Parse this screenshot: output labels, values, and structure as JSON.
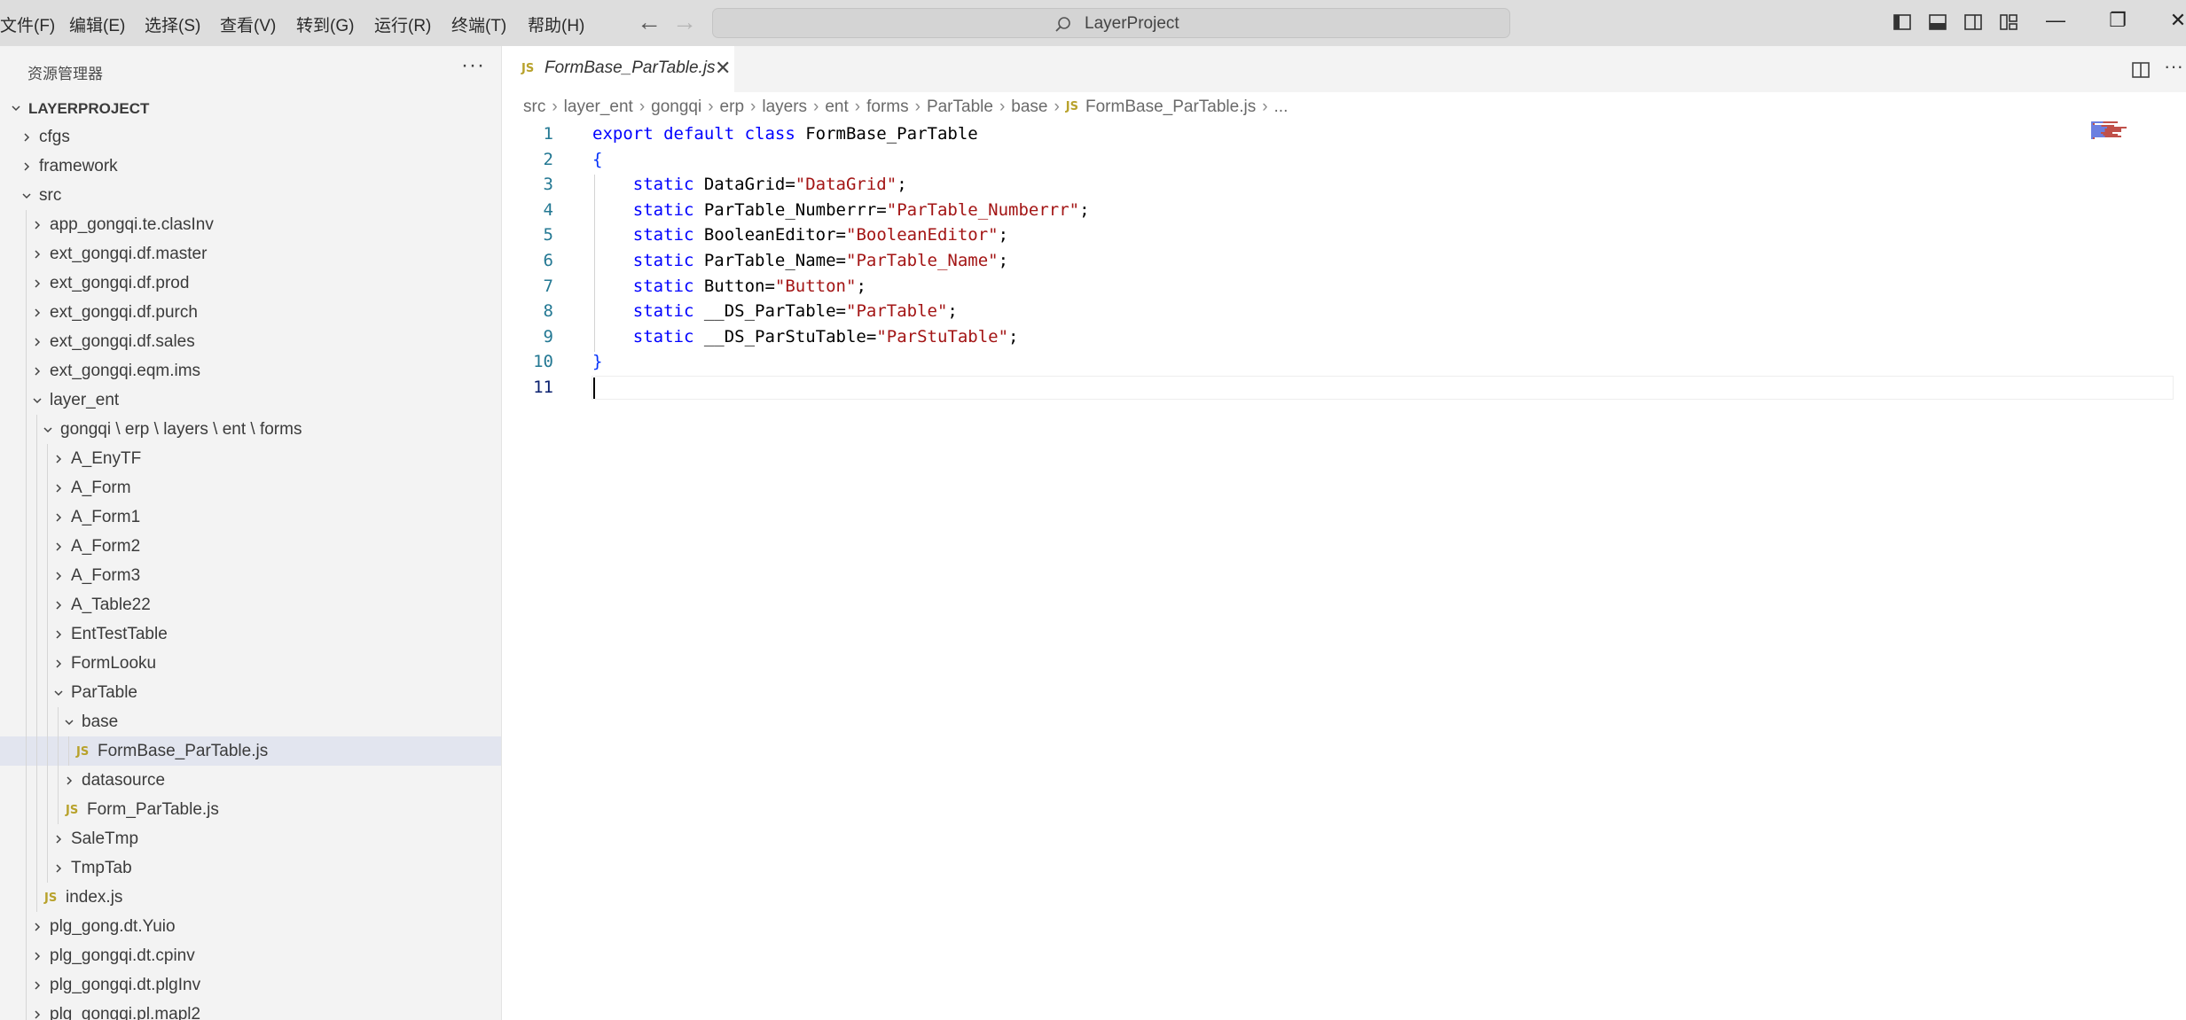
{
  "menu": [
    "文件(F)",
    "编辑(E)",
    "选择(S)",
    "查看(V)",
    "转到(G)",
    "运行(R)",
    "终端(T)",
    "帮助(H)"
  ],
  "title": {
    "search_text": "LayerProject"
  },
  "window_controls": {
    "minimize": "—",
    "restore": "❐",
    "close": "✕"
  },
  "sidebar": {
    "title": "资源管理器",
    "more": "···",
    "tree": [
      {
        "label": "LAYERPROJECT",
        "level": 0,
        "kind": "root-open"
      },
      {
        "label": "cfgs",
        "level": 1,
        "kind": "folder-closed"
      },
      {
        "label": "framework",
        "level": 1,
        "kind": "folder-closed"
      },
      {
        "label": "src",
        "level": 1,
        "kind": "folder-open"
      },
      {
        "label": "app_gongqi.te.clasInv",
        "level": 2,
        "kind": "folder-closed"
      },
      {
        "label": "ext_gongqi.df.master",
        "level": 2,
        "kind": "folder-closed"
      },
      {
        "label": "ext_gongqi.df.prod",
        "level": 2,
        "kind": "folder-closed"
      },
      {
        "label": "ext_gongqi.df.purch",
        "level": 2,
        "kind": "folder-closed"
      },
      {
        "label": "ext_gongqi.df.sales",
        "level": 2,
        "kind": "folder-closed"
      },
      {
        "label": "ext_gongqi.eqm.ims",
        "level": 2,
        "kind": "folder-closed"
      },
      {
        "label": "layer_ent",
        "level": 2,
        "kind": "folder-open"
      },
      {
        "label": "gongqi \\ erp \\ layers \\ ent \\ forms",
        "level": 3,
        "kind": "folder-open"
      },
      {
        "label": "A_EnyTF",
        "level": 4,
        "kind": "folder-closed"
      },
      {
        "label": "A_Form",
        "level": 4,
        "kind": "folder-closed"
      },
      {
        "label": "A_Form1",
        "level": 4,
        "kind": "folder-closed"
      },
      {
        "label": "A_Form2",
        "level": 4,
        "kind": "folder-closed"
      },
      {
        "label": "A_Form3",
        "level": 4,
        "kind": "folder-closed"
      },
      {
        "label": "A_Table22",
        "level": 4,
        "kind": "folder-closed"
      },
      {
        "label": "EntTestTable",
        "level": 4,
        "kind": "folder-closed"
      },
      {
        "label": "FormLooku",
        "level": 4,
        "kind": "folder-closed"
      },
      {
        "label": "ParTable",
        "level": 4,
        "kind": "folder-open"
      },
      {
        "label": "base",
        "level": 5,
        "kind": "folder-open"
      },
      {
        "label": "FormBase_ParTable.js",
        "level": 6,
        "kind": "js-file",
        "selected": true
      },
      {
        "label": "datasource",
        "level": 5,
        "kind": "folder-closed"
      },
      {
        "label": "Form_ParTable.js",
        "level": 5,
        "kind": "js-file"
      },
      {
        "label": "SaleTmp",
        "level": 4,
        "kind": "folder-closed"
      },
      {
        "label": "TmpTab",
        "level": 4,
        "kind": "folder-closed"
      },
      {
        "label": "index.js",
        "level": 3,
        "kind": "js-file"
      },
      {
        "label": "plg_gong.dt.Yuio",
        "level": 2,
        "kind": "folder-closed"
      },
      {
        "label": "plg_gongqi.dt.cpinv",
        "level": 2,
        "kind": "folder-closed"
      },
      {
        "label": "plg_gongqi.dt.plgInv",
        "level": 2,
        "kind": "folder-closed"
      },
      {
        "label": "plg_gongqi.pl.mapl2",
        "level": 2,
        "kind": "folder-closed"
      }
    ]
  },
  "tab": {
    "badge": "JS",
    "name": "FormBase_ParTable.js",
    "close": "✕"
  },
  "editor_more": "···",
  "breadcrumb": [
    "src",
    "layer_ent",
    "gongqi",
    "erp",
    "layers",
    "ent",
    "forms",
    "ParTable",
    "base",
    "FormBase_ParTable.js",
    "..."
  ],
  "code_lines": [
    [
      {
        "t": "export ",
        "c": "kw"
      },
      {
        "t": "default ",
        "c": "kw"
      },
      {
        "t": "class ",
        "c": "kw"
      },
      {
        "t": "FormBase_ParTable",
        "c": ""
      }
    ],
    [
      {
        "t": "{",
        "c": "brace"
      }
    ],
    [
      {
        "t": "    ",
        "c": ""
      },
      {
        "t": "static ",
        "c": "kw"
      },
      {
        "t": "DataGrid=",
        "c": ""
      },
      {
        "t": "\"DataGrid\"",
        "c": "str"
      },
      {
        "t": ";",
        "c": ""
      }
    ],
    [
      {
        "t": "    ",
        "c": ""
      },
      {
        "t": "static ",
        "c": "kw"
      },
      {
        "t": "ParTable_Numberrr=",
        "c": ""
      },
      {
        "t": "\"ParTable_Numberrr\"",
        "c": "str"
      },
      {
        "t": ";",
        "c": ""
      }
    ],
    [
      {
        "t": "    ",
        "c": ""
      },
      {
        "t": "static ",
        "c": "kw"
      },
      {
        "t": "BooleanEditor=",
        "c": ""
      },
      {
        "t": "\"BooleanEditor\"",
        "c": "str"
      },
      {
        "t": ";",
        "c": ""
      }
    ],
    [
      {
        "t": "    ",
        "c": ""
      },
      {
        "t": "static ",
        "c": "kw"
      },
      {
        "t": "ParTable_Name=",
        "c": ""
      },
      {
        "t": "\"ParTable_Name\"",
        "c": "str"
      },
      {
        "t": ";",
        "c": ""
      }
    ],
    [
      {
        "t": "    ",
        "c": ""
      },
      {
        "t": "static ",
        "c": "kw"
      },
      {
        "t": "Button=",
        "c": ""
      },
      {
        "t": "\"Button\"",
        "c": "str"
      },
      {
        "t": ";",
        "c": ""
      }
    ],
    [
      {
        "t": "    ",
        "c": ""
      },
      {
        "t": "static ",
        "c": "kw"
      },
      {
        "t": "__DS_ParTable=",
        "c": ""
      },
      {
        "t": "\"ParTable\"",
        "c": "str"
      },
      {
        "t": ";",
        "c": ""
      }
    ],
    [
      {
        "t": "    ",
        "c": ""
      },
      {
        "t": "static ",
        "c": "kw"
      },
      {
        "t": "__DS_ParStuTable=",
        "c": ""
      },
      {
        "t": "\"ParStuTable\"",
        "c": "str"
      },
      {
        "t": ";",
        "c": ""
      }
    ],
    [
      {
        "t": "}",
        "c": "brace"
      }
    ],
    []
  ],
  "current_line": 11,
  "colors": {
    "keyword": "#0000ff",
    "string": "#a31515",
    "brace": "#0431fa",
    "line_number": "#237893",
    "js_badge": "#b8a22c"
  }
}
